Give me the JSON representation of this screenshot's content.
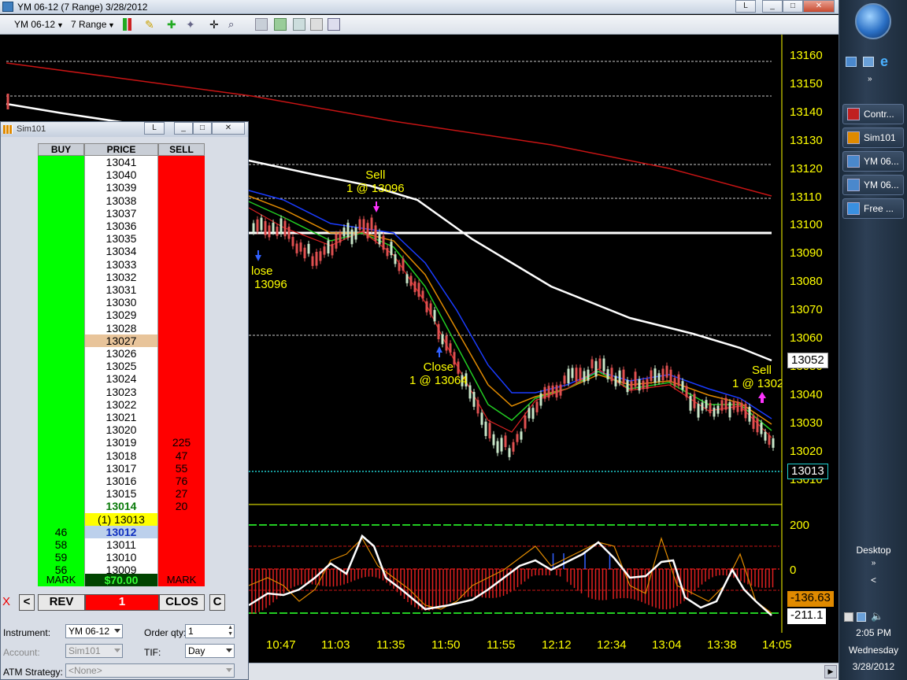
{
  "window": {
    "title": "YM 06-12 (7 Range)  3/28/2012",
    "buttons": {
      "pin": "L",
      "minimize": "_",
      "maximize": "□",
      "close": "✕"
    }
  },
  "toolbar": {
    "instrument": "YM 06-12",
    "period": "7 Range"
  },
  "chart": {
    "price_ticks": [
      "13160",
      "13150",
      "13140",
      "13130",
      "13120",
      "13110",
      "13100",
      "13090",
      "13080",
      "13070",
      "13060",
      "13050",
      "13040",
      "13030",
      "13020",
      "13010"
    ],
    "time_ticks": [
      "10:47",
      "11:03",
      "11:35",
      "11:50",
      "11:55",
      "12:12",
      "12:34",
      "13:04",
      "13:38",
      "14:05"
    ],
    "current_price": "13013",
    "marker_price": "13052",
    "indicator_ticks": [
      "200",
      "0"
    ],
    "indicator_values": {
      "orange": "-136.63",
      "white": "-211.1"
    },
    "annotations": [
      {
        "line1": "Sell",
        "line2": "1 @ 13096"
      },
      {
        "line1": "lose",
        "line2": "13096"
      },
      {
        "line1": "Close",
        "line2": "1 @ 13064"
      },
      {
        "line1": "Sell",
        "line2": "1 @ 1302"
      }
    ],
    "colors": {
      "price": "#ffff00",
      "bull": "#c8e6c8",
      "bear": "#e05050",
      "ma_white": "#ffffff",
      "ma_red": "#c81414"
    }
  },
  "dom": {
    "title": "Sim101",
    "pin": "L",
    "headers": {
      "buy": "BUY",
      "price": "PRICE",
      "sell": "SELL"
    },
    "rows": [
      {
        "buy": "",
        "price": "13041",
        "sell": ""
      },
      {
        "buy": "",
        "price": "13040",
        "sell": ""
      },
      {
        "buy": "",
        "price": "13039",
        "sell": ""
      },
      {
        "buy": "",
        "price": "13038",
        "sell": ""
      },
      {
        "buy": "",
        "price": "13037",
        "sell": ""
      },
      {
        "buy": "",
        "price": "13036",
        "sell": ""
      },
      {
        "buy": "",
        "price": "13035",
        "sell": ""
      },
      {
        "buy": "",
        "price": "13034",
        "sell": ""
      },
      {
        "buy": "",
        "price": "13033",
        "sell": ""
      },
      {
        "buy": "",
        "price": "13032",
        "sell": ""
      },
      {
        "buy": "",
        "price": "13031",
        "sell": ""
      },
      {
        "buy": "",
        "price": "13030",
        "sell": ""
      },
      {
        "buy": "",
        "price": "13029",
        "sell": ""
      },
      {
        "buy": "",
        "price": "13028",
        "sell": ""
      },
      {
        "buy": "",
        "price": "13027",
        "sell": ""
      },
      {
        "buy": "",
        "price": "13026",
        "sell": ""
      },
      {
        "buy": "",
        "price": "13025",
        "sell": ""
      },
      {
        "buy": "",
        "price": "13024",
        "sell": ""
      },
      {
        "buy": "",
        "price": "13023",
        "sell": ""
      },
      {
        "buy": "",
        "price": "13022",
        "sell": ""
      },
      {
        "buy": "",
        "price": "13021",
        "sell": ""
      },
      {
        "buy": "",
        "price": "13020",
        "sell": ""
      },
      {
        "buy": "",
        "price": "13019",
        "sell": "225"
      },
      {
        "buy": "",
        "price": "13018",
        "sell": "47"
      },
      {
        "buy": "",
        "price": "13017",
        "sell": "55"
      },
      {
        "buy": "",
        "price": "13016",
        "sell": "76"
      },
      {
        "buy": "",
        "price": "13015",
        "sell": "27"
      },
      {
        "buy": "",
        "price": "13014",
        "sell": "20"
      },
      {
        "buy": "",
        "price": "(1) 13013",
        "sell": ""
      },
      {
        "buy": "46",
        "price": "13012",
        "sell": ""
      },
      {
        "buy": "58",
        "price": "13011",
        "sell": ""
      },
      {
        "buy": "59",
        "price": "13010",
        "sell": ""
      },
      {
        "buy": "56",
        "price": "13009",
        "sell": ""
      }
    ],
    "footer": {
      "buy": "MARK",
      "pnl": "$70.00",
      "sell": "MARK"
    },
    "controls": {
      "x": "X",
      "left": "<",
      "rev": "REV",
      "qty": "1",
      "close": "CLOS",
      "c": "C"
    },
    "form": {
      "instrument_label": "Instrument:",
      "instrument_value": "YM 06-12",
      "account_label": "Account:",
      "account_value": "Sim101",
      "atm_label": "ATM Strategy:",
      "atm_value": "<None>",
      "order_qty_label": "Order qty:",
      "order_qty_value": "1",
      "tif_label": "TIF:",
      "tif_value": "Day"
    }
  },
  "taskbar": {
    "items": [
      "Contr...",
      "Sim101",
      "YM 06...",
      "YM 06...",
      "Free ..."
    ],
    "desktop": "Desktop",
    "time": "2:05 PM",
    "day": "Wednesday",
    "date": "3/28/2012"
  }
}
